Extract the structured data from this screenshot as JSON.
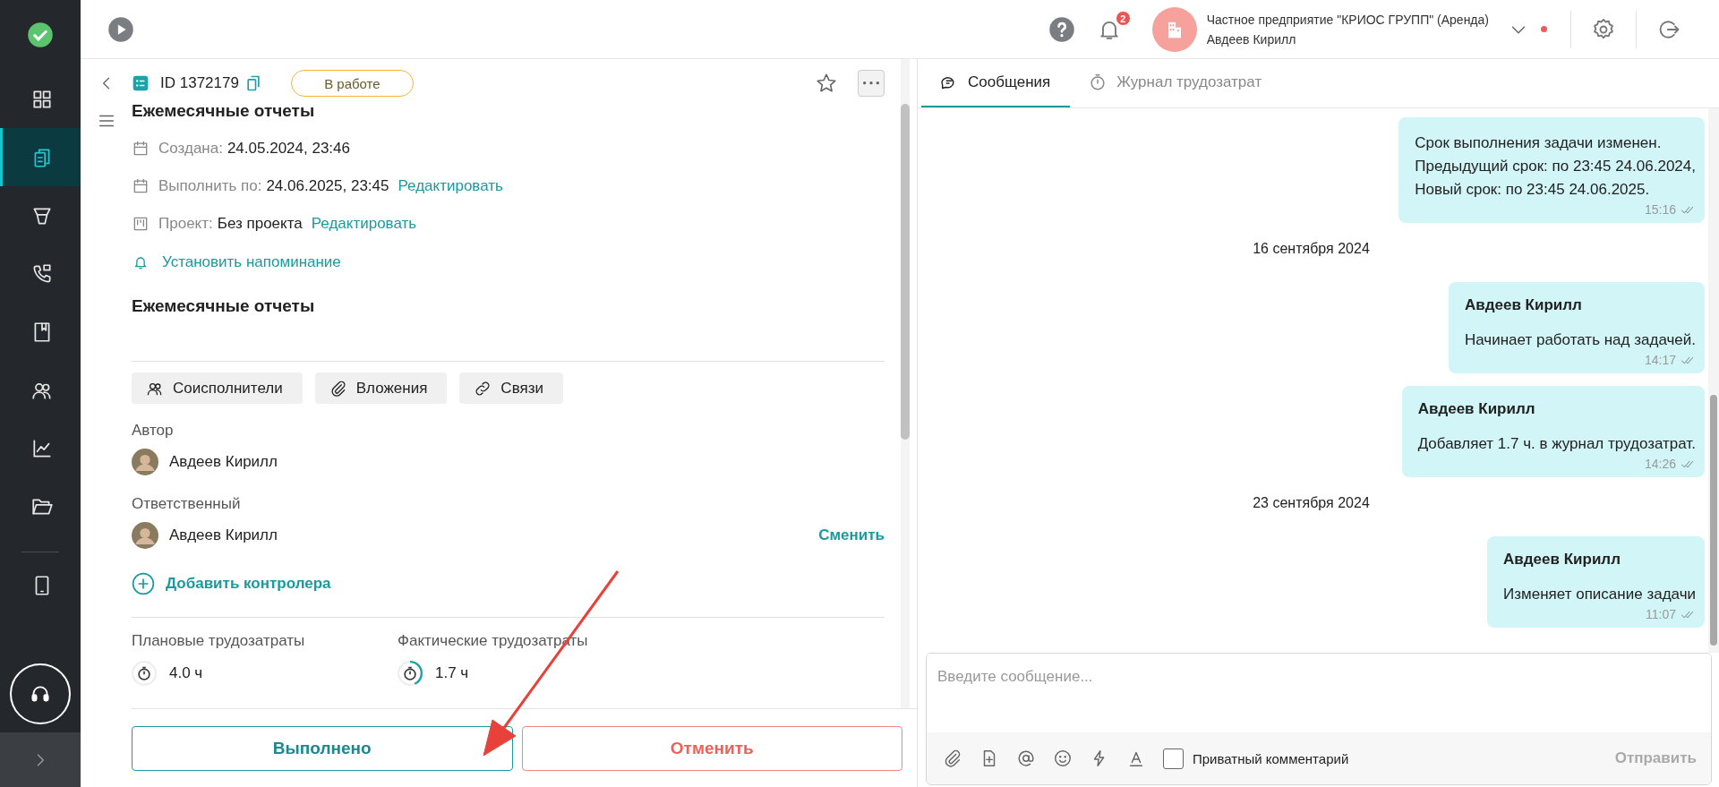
{
  "sidebar": {
    "items": [
      {
        "selected": false
      },
      {
        "selected": true
      },
      {
        "selected": false
      },
      {
        "selected": false
      },
      {
        "selected": false
      },
      {
        "selected": false
      },
      {
        "selected": false
      },
      {
        "selected": false
      },
      {
        "selected": false
      }
    ]
  },
  "topbar": {
    "notifications": "2",
    "company": "Частное предприятие \"КРИОС ГРУПП\" (Аренда)",
    "user": "Авдеев Кирилл"
  },
  "task": {
    "id": "ID 1372179",
    "status": "В работе",
    "starred": false,
    "title": "Ежемесячные отчеты",
    "meta": [
      {
        "kind": "date",
        "label": "Создана:",
        "value": "24.05.2024, 23:46"
      },
      {
        "kind": "date",
        "label": "Выполнить по:",
        "value": "24.06.2025, 23:45",
        "link": "Редактировать"
      },
      {
        "kind": "project",
        "label": "Проект:",
        "value": "Без проекта",
        "link": "Редактировать"
      }
    ],
    "reminder": "Установить напоминание",
    "description": "Ежемесячные отчеты",
    "buttons": [
      {
        "kind": "people",
        "label": "Соисполнители"
      },
      {
        "kind": "clip",
        "label": "Вложения"
      },
      {
        "kind": "link",
        "label": "Связи"
      }
    ],
    "author": {
      "label": "Автор",
      "name": "Авдеев Кирилл"
    },
    "responsible": {
      "label": "Ответственный",
      "name": "Авдеев Кирилл",
      "action": "Сменить"
    },
    "add_controller": "Добавить контролера",
    "efforts": [
      {
        "label": "Плановые трудозатраты",
        "value": "4.0 ч"
      },
      {
        "label": "Фактические трудозатраты",
        "value": "1.7 ч",
        "level": 0.43
      }
    ],
    "footer": [
      {
        "kind": "primary",
        "label": "Выполнено"
      },
      {
        "kind": "danger",
        "label": "Отменить"
      }
    ]
  },
  "chat": {
    "tabs": [
      {
        "label": "Сообщения",
        "selected": true
      },
      {
        "label": "Журнал трудозатрат",
        "selected": false
      }
    ],
    "items": [
      {
        "kind": "message",
        "text": "Срок выполнения задачи изменен.\nПредыдущий срок: по 23:45 24.06.2024,\nНовый срок: по 23:45 24.06.2025.",
        "time": "15:16",
        "read": true
      },
      {
        "kind": "date",
        "text": "16 сентября 2024"
      },
      {
        "kind": "message",
        "author": "Авдеев Кирилл",
        "text": "Начинает работать над задачей.",
        "time": "14:17",
        "read": true
      },
      {
        "kind": "message",
        "author": "Авдеев Кирилл",
        "text": "Добавляет 1.7 ч. в журнал трудозатрат.",
        "time": "14:26",
        "read": true
      },
      {
        "kind": "date",
        "text": "23 сентября 2024"
      },
      {
        "kind": "message",
        "author": "Авдеев Кирилл",
        "text": "Изменяет описание задачи",
        "time": "11:07",
        "read": true
      }
    ],
    "placeholder": "Введите сообщение...",
    "private": {
      "label": "Приватный комментарий",
      "checked": false
    },
    "send": {
      "label": "Отправить",
      "disabled": true
    }
  }
}
